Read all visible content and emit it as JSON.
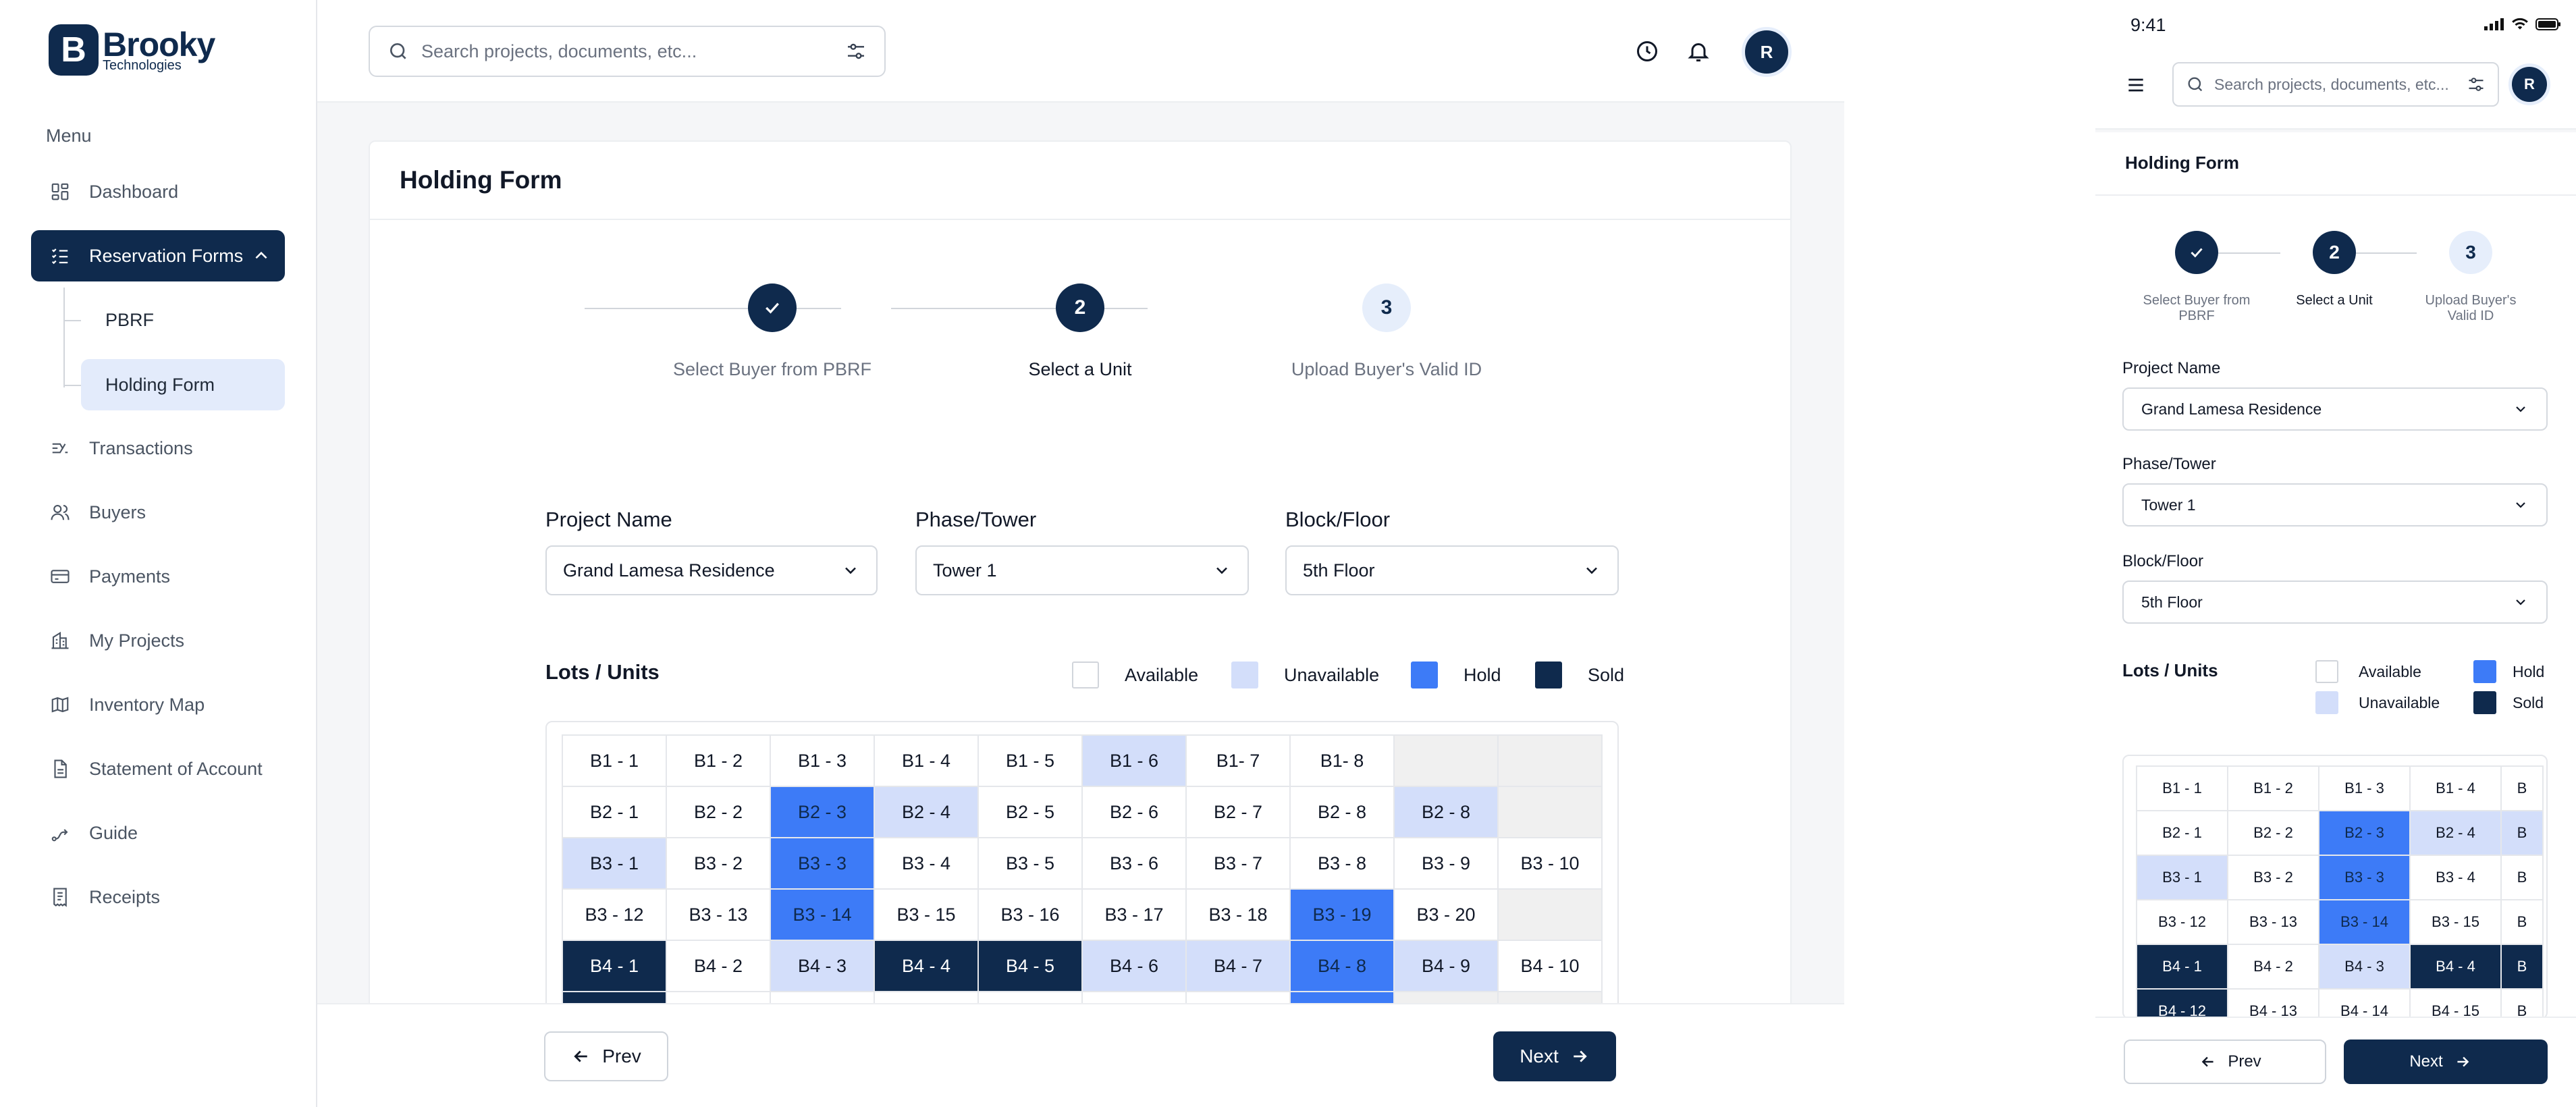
{
  "brand": {
    "name": "Brooky",
    "tagline": "Technologies",
    "mark": "B"
  },
  "sidebar": {
    "menu_label": "Menu",
    "items": [
      {
        "label": "Dashboard",
        "icon": "grid-icon"
      },
      {
        "label": "Reservation Forms",
        "icon": "checklist-icon"
      },
      {
        "label": "Transactions",
        "icon": "transactions-icon"
      },
      {
        "label": "Buyers",
        "icon": "users-icon"
      },
      {
        "label": "Payments",
        "icon": "card-icon"
      },
      {
        "label": "My Projects",
        "icon": "building-icon"
      },
      {
        "label": "Inventory Map",
        "icon": "map-icon"
      },
      {
        "label": "Statement of Account",
        "icon": "document-icon"
      },
      {
        "label": "Guide",
        "icon": "route-icon"
      },
      {
        "label": "Receipts",
        "icon": "receipt-icon"
      }
    ],
    "sub_items": [
      {
        "label": "PBRF"
      },
      {
        "label": "Holding Form"
      }
    ]
  },
  "search": {
    "placeholder": "Search projects, documents, etc..."
  },
  "user": {
    "initial": "R"
  },
  "form": {
    "title": "Holding Form",
    "steps": [
      {
        "number": "1",
        "label": "Select Buyer from PBRF",
        "state": "done"
      },
      {
        "number": "2",
        "label": "Select a Unit",
        "state": "current"
      },
      {
        "number": "3",
        "label": "Upload Buyer's Valid ID",
        "state": "todo"
      }
    ],
    "project_name": {
      "label": "Project Name",
      "value": "Grand Lamesa Residence"
    },
    "phase_tower": {
      "label": "Phase/Tower",
      "value": "Tower 1"
    },
    "block_floor": {
      "label": "Block/Floor",
      "value": "5th Floor"
    },
    "units_title": "Lots / Units",
    "legend": [
      {
        "label": "Available",
        "status": "available"
      },
      {
        "label": "Unavailable",
        "status": "unavailable"
      },
      {
        "label": "Hold",
        "status": "hold"
      },
      {
        "label": "Sold",
        "status": "sold"
      }
    ],
    "units": [
      [
        {
          "l": "B1 - 1",
          "s": "available"
        },
        {
          "l": "B1 - 2",
          "s": "available"
        },
        {
          "l": "B1 - 3",
          "s": "available"
        },
        {
          "l": "B1 - 4",
          "s": "available"
        },
        {
          "l": "B1 - 5",
          "s": "available"
        },
        {
          "l": "B1 - 6",
          "s": "unavailable"
        },
        {
          "l": "B1- 7",
          "s": "available"
        },
        {
          "l": "B1- 8",
          "s": "available"
        },
        {
          "l": "",
          "s": "empty"
        },
        {
          "l": "",
          "s": "empty"
        }
      ],
      [
        {
          "l": "B2 - 1",
          "s": "available"
        },
        {
          "l": "B2 - 2",
          "s": "available"
        },
        {
          "l": "B2 - 3",
          "s": "hold"
        },
        {
          "l": "B2 - 4",
          "s": "unavailable"
        },
        {
          "l": "B2 - 5",
          "s": "available"
        },
        {
          "l": "B2 - 6",
          "s": "available"
        },
        {
          "l": "B2 - 7",
          "s": "available"
        },
        {
          "l": "B2 - 8",
          "s": "available"
        },
        {
          "l": "B2 - 8",
          "s": "unavailable"
        },
        {
          "l": "",
          "s": "empty"
        }
      ],
      [
        {
          "l": "B3 - 1",
          "s": "unavailable"
        },
        {
          "l": "B3 - 2",
          "s": "available"
        },
        {
          "l": "B3 - 3",
          "s": "hold"
        },
        {
          "l": "B3 - 4",
          "s": "available"
        },
        {
          "l": "B3 - 5",
          "s": "available"
        },
        {
          "l": "B3 - 6",
          "s": "available"
        },
        {
          "l": "B3 - 7",
          "s": "available"
        },
        {
          "l": "B3 - 8",
          "s": "available"
        },
        {
          "l": "B3 - 9",
          "s": "available"
        },
        {
          "l": "B3 - 10",
          "s": "available"
        }
      ],
      [
        {
          "l": "B3 - 12",
          "s": "available"
        },
        {
          "l": "B3 - 13",
          "s": "available"
        },
        {
          "l": "B3 - 14",
          "s": "hold"
        },
        {
          "l": "B3 - 15",
          "s": "available"
        },
        {
          "l": "B3 - 16",
          "s": "available"
        },
        {
          "l": "B3 - 17",
          "s": "available"
        },
        {
          "l": "B3 - 18",
          "s": "available"
        },
        {
          "l": "B3 - 19",
          "s": "hold"
        },
        {
          "l": "B3 - 20",
          "s": "available"
        },
        {
          "l": "",
          "s": "empty"
        }
      ],
      [
        {
          "l": "B4 - 1",
          "s": "sold"
        },
        {
          "l": "B4 - 2",
          "s": "available"
        },
        {
          "l": "B4 - 3",
          "s": "unavailable"
        },
        {
          "l": "B4 - 4",
          "s": "sold"
        },
        {
          "l": "B4 - 5",
          "s": "sold"
        },
        {
          "l": "B4 - 6",
          "s": "unavailable"
        },
        {
          "l": "B4 - 7",
          "s": "unavailable"
        },
        {
          "l": "B4 - 8",
          "s": "hold"
        },
        {
          "l": "B4 - 9",
          "s": "unavailable"
        },
        {
          "l": "B4 - 10",
          "s": "available"
        }
      ],
      [
        {
          "l": "",
          "s": "sold"
        },
        {
          "l": "",
          "s": "available"
        },
        {
          "l": "",
          "s": "available"
        },
        {
          "l": "",
          "s": "available"
        },
        {
          "l": "",
          "s": "available"
        },
        {
          "l": "",
          "s": "available"
        },
        {
          "l": "",
          "s": "available"
        },
        {
          "l": "",
          "s": "hold"
        },
        {
          "l": "",
          "s": "empty"
        },
        {
          "l": "",
          "s": "empty"
        }
      ]
    ],
    "prev_label": "Prev",
    "next_label": "Next"
  },
  "mobile": {
    "time": "9:41",
    "units": [
      [
        {
          "l": "B1 - 1",
          "s": "available"
        },
        {
          "l": "B1 - 2",
          "s": "available"
        },
        {
          "l": "B1 - 3",
          "s": "available"
        },
        {
          "l": "B1 - 4",
          "s": "available"
        },
        {
          "l": "B",
          "s": "available"
        }
      ],
      [
        {
          "l": "B2 - 1",
          "s": "available"
        },
        {
          "l": "B2 - 2",
          "s": "available"
        },
        {
          "l": "B2 - 3",
          "s": "hold"
        },
        {
          "l": "B2 - 4",
          "s": "unavailable"
        },
        {
          "l": "B",
          "s": "unavailable"
        }
      ],
      [
        {
          "l": "B3 - 1",
          "s": "unavailable"
        },
        {
          "l": "B3 - 2",
          "s": "available"
        },
        {
          "l": "B3 - 3",
          "s": "hold"
        },
        {
          "l": "B3 - 4",
          "s": "available"
        },
        {
          "l": "B",
          "s": "available"
        }
      ],
      [
        {
          "l": "B3 - 12",
          "s": "available"
        },
        {
          "l": "B3 - 13",
          "s": "available"
        },
        {
          "l": "B3 - 14",
          "s": "hold"
        },
        {
          "l": "B3 - 15",
          "s": "available"
        },
        {
          "l": "B",
          "s": "available"
        }
      ],
      [
        {
          "l": "B4 - 1",
          "s": "sold"
        },
        {
          "l": "B4 - 2",
          "s": "available"
        },
        {
          "l": "B4 - 3",
          "s": "unavailable"
        },
        {
          "l": "B4 - 4",
          "s": "sold"
        },
        {
          "l": "B",
          "s": "sold"
        }
      ],
      [
        {
          "l": "B4 - 12",
          "s": "sold"
        },
        {
          "l": "B4 - 13",
          "s": "available"
        },
        {
          "l": "B4 - 14",
          "s": "available"
        },
        {
          "l": "B4 - 15",
          "s": "available"
        },
        {
          "l": "B",
          "s": "available"
        }
      ]
    ]
  },
  "colors": {
    "primary": "#0f2a4d",
    "hold": "#3d7bf7",
    "unavailable": "#d3defa",
    "active_sub": "#e3ebfb"
  }
}
